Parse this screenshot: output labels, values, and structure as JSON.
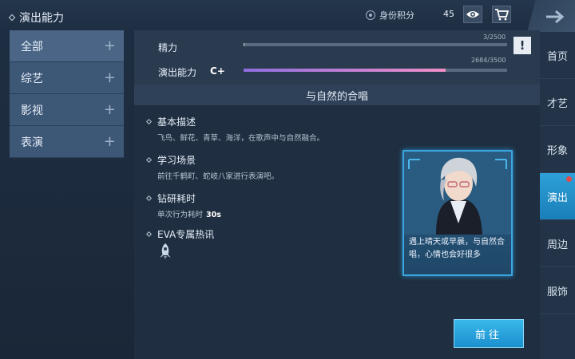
{
  "header": {
    "title": "演出能力",
    "identity_label": "身份积分",
    "identity_score": "45",
    "icons": [
      "identity-badge-icon",
      "eye-icon",
      "cart-icon",
      "back-arrow-icon"
    ]
  },
  "categories": [
    {
      "label": "全部"
    },
    {
      "label": "综艺"
    },
    {
      "label": "影视"
    },
    {
      "label": "表演"
    }
  ],
  "stats": {
    "energy": {
      "label": "精力",
      "value": 3,
      "max": 2500,
      "text": "3/2500",
      "color": "#c8d2dd"
    },
    "performance": {
      "label": "演出能力",
      "grade": "C+",
      "value": 2684,
      "max": 3500,
      "text": "2684/3500",
      "color_start": "#8f6ee0",
      "color_end": "#f08fc8"
    },
    "help_icon": "!"
  },
  "activity": {
    "title": "与自然的合唱",
    "sections": [
      {
        "head": "基本描述",
        "body": "飞鸟、鲜花、青草、海洋，在歌声中与自然融合。"
      },
      {
        "head": "学习场景",
        "body": "前往千鹤町、蛇岐八家进行表演吧。"
      },
      {
        "head": "钻研耗时",
        "body": "单次行为耗时",
        "value": "30s"
      },
      {
        "head": "EVA专属热讯",
        "body": ""
      }
    ],
    "card_text": "遇上晴天或早晨，与自然合唱，心情也会好很多",
    "go_label": "前往"
  },
  "right_nav": [
    {
      "label": "首页",
      "active": false
    },
    {
      "label": "才艺",
      "active": false
    },
    {
      "label": "形象",
      "active": false
    },
    {
      "label": "演出",
      "active": true,
      "badge": true
    },
    {
      "label": "周边",
      "active": false
    },
    {
      "label": "服饰",
      "active": false
    }
  ],
  "colors": {
    "accent": "#2ea0d8",
    "panel": "#1f2e40",
    "category_bg": "#3d5777",
    "badge_red": "#e24b4b"
  }
}
